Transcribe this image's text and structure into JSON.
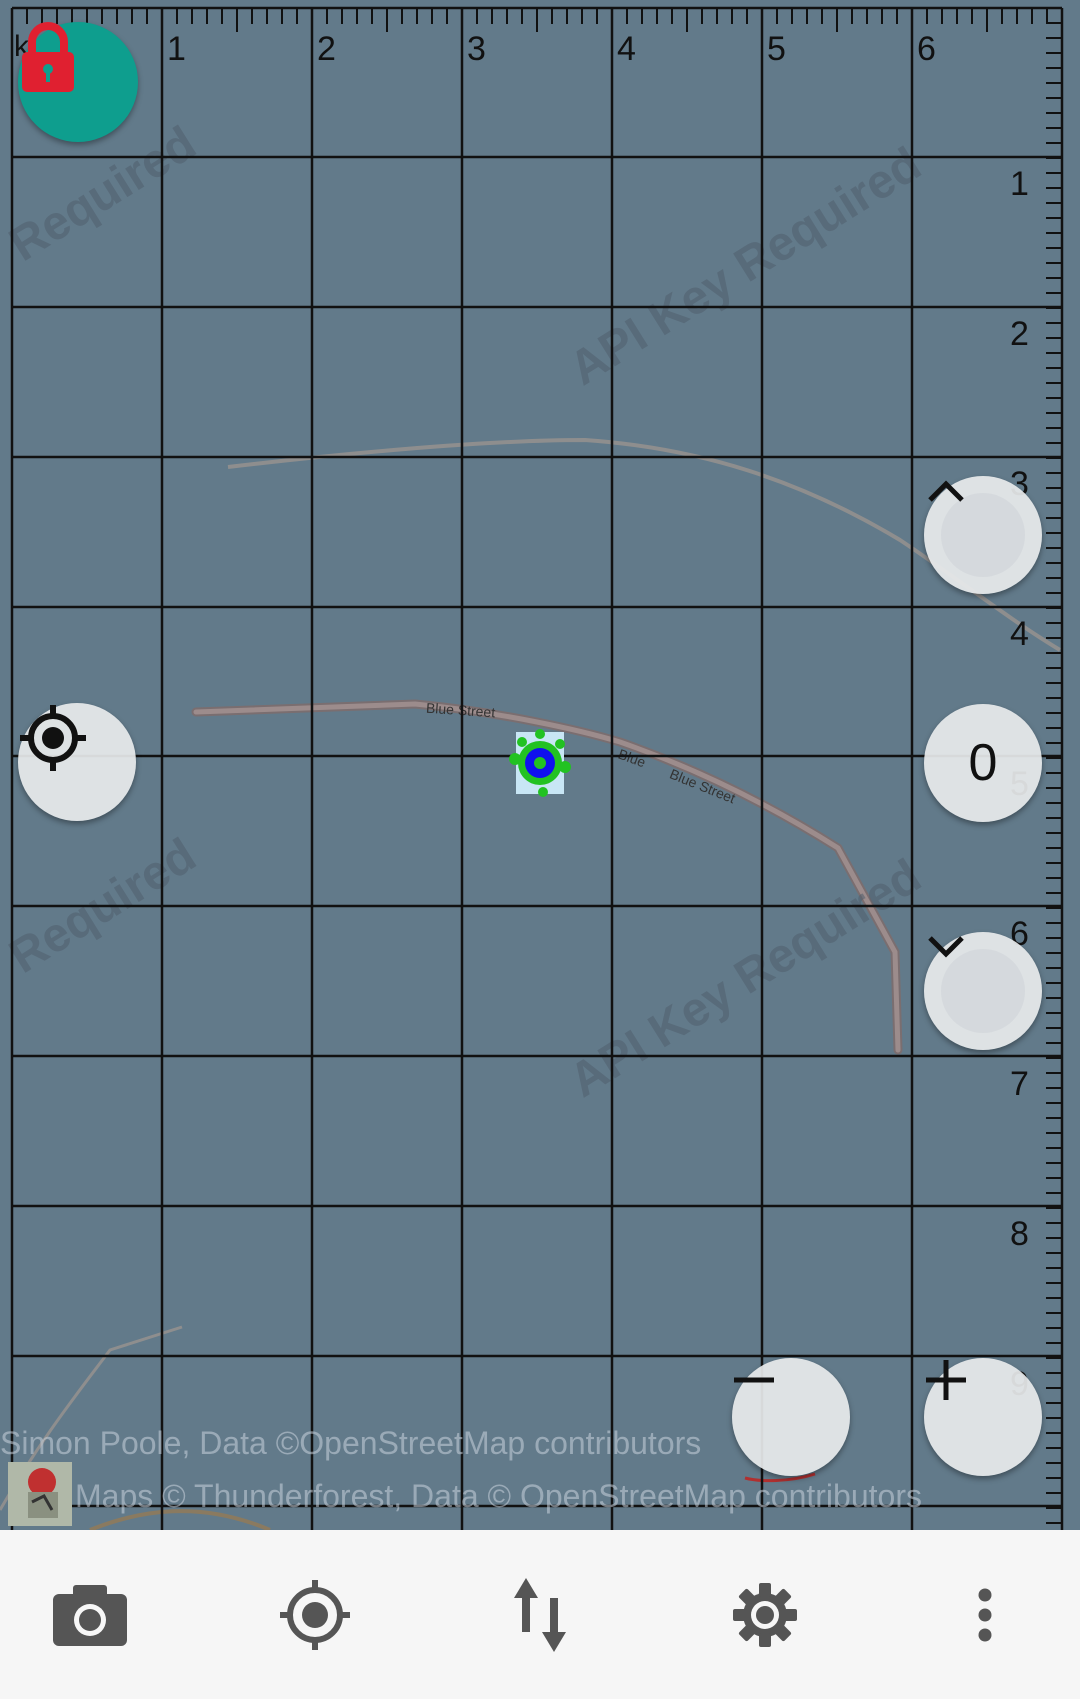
{
  "map": {
    "scale_unit": "km",
    "top_ruler_labels": [
      "1",
      "2",
      "3",
      "4",
      "5",
      "6"
    ],
    "right_ruler_labels": [
      "1",
      "2",
      "3",
      "4",
      "5",
      "6",
      "7",
      "8",
      "9"
    ],
    "watermark_text": "API Key Required",
    "watermark_text_partial": "Required",
    "street_labels": [
      "Blue Street",
      "Blue",
      "Blue Street"
    ],
    "level_value": "0",
    "attribution_line1": "Simon Poole, Data ©OpenStreetMap contributors",
    "attribution_line2": "Maps © Thunderforest, Data © OpenStreetMap contributors"
  },
  "controls": {
    "lock_icon": "lock-icon",
    "gps_icon": "crosshair-icon",
    "level_up_icon": "chevron-up-icon",
    "level_down_icon": "chevron-down-icon",
    "zoom_out_icon": "minus-icon",
    "zoom_in_icon": "plus-icon"
  },
  "toolbar": {
    "items": [
      "camera-icon",
      "gps-location-icon",
      "transfer-icon",
      "settings-icon",
      "more-vert-icon"
    ]
  },
  "colors": {
    "map_background": "#627a8a",
    "lock_fab": "#0e9e8e",
    "lock_icon": "#e02030",
    "gps_marker": "#1010ee",
    "toolbar_bg": "#f6f6f6"
  }
}
